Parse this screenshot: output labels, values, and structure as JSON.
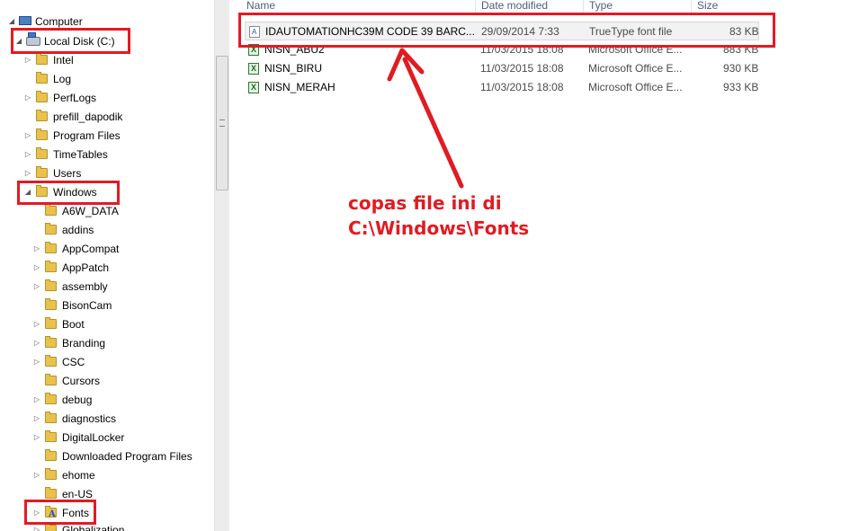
{
  "nav": {
    "items": [
      {
        "label": "Computer",
        "icon": "computer-icon",
        "expanded": true
      },
      {
        "label": "Local Disk (C:)",
        "icon": "local-disk-icon",
        "expanded": true
      },
      {
        "label": "Intel",
        "icon": "folder-icon"
      },
      {
        "label": "Log",
        "icon": "folder-icon"
      },
      {
        "label": "PerfLogs",
        "icon": "folder-icon"
      },
      {
        "label": "prefill_dapodik",
        "icon": "folder-icon"
      },
      {
        "label": "Program Files",
        "icon": "folder-icon"
      },
      {
        "label": "TimeTables",
        "icon": "folder-icon"
      },
      {
        "label": "Users",
        "icon": "folder-icon"
      },
      {
        "label": "Windows",
        "icon": "folder-icon",
        "expanded": true
      },
      {
        "label": "A6W_DATA",
        "icon": "folder-icon"
      },
      {
        "label": "addins",
        "icon": "folder-icon"
      },
      {
        "label": "AppCompat",
        "icon": "folder-icon"
      },
      {
        "label": "AppPatch",
        "icon": "folder-icon"
      },
      {
        "label": "assembly",
        "icon": "folder-icon"
      },
      {
        "label": "BisonCam",
        "icon": "folder-icon"
      },
      {
        "label": "Boot",
        "icon": "folder-icon"
      },
      {
        "label": "Branding",
        "icon": "folder-icon"
      },
      {
        "label": "CSC",
        "icon": "folder-icon"
      },
      {
        "label": "Cursors",
        "icon": "folder-icon"
      },
      {
        "label": "debug",
        "icon": "folder-icon"
      },
      {
        "label": "diagnostics",
        "icon": "folder-icon"
      },
      {
        "label": "DigitalLocker",
        "icon": "folder-icon"
      },
      {
        "label": "Downloaded Program Files",
        "icon": "folder-icon"
      },
      {
        "label": "ehome",
        "icon": "folder-icon"
      },
      {
        "label": "en-US",
        "icon": "folder-icon"
      },
      {
        "label": "Fonts",
        "icon": "fonts-folder-icon"
      },
      {
        "label": "Globalization",
        "icon": "folder-icon"
      }
    ]
  },
  "files": {
    "columns": {
      "name": "Name",
      "date": "Date modified",
      "type": "Type",
      "size": "Size"
    },
    "rows": [
      {
        "name": "IDAUTOMATIONHC39M CODE 39 BARC...",
        "date": "29/09/2014 7:33",
        "type": "TrueType font file",
        "size": "83 KB",
        "icon": "font-file-icon",
        "selected": true
      },
      {
        "name": "NISN_ABU2",
        "date": "11/03/2015 18:08",
        "type": "Microsoft Office E...",
        "size": "883 KB",
        "icon": "excel-file-icon"
      },
      {
        "name": "NISN_BIRU",
        "date": "11/03/2015 18:08",
        "type": "Microsoft Office E...",
        "size": "930 KB",
        "icon": "excel-file-icon"
      },
      {
        "name": "NISN_MERAH",
        "date": "11/03/2015 18:08",
        "type": "Microsoft Office E...",
        "size": "933 KB",
        "icon": "excel-file-icon"
      }
    ]
  },
  "annotation": {
    "line1": "copas file ini di",
    "line2": "C:\\Windows\\Fonts",
    "color": "#e11b22"
  }
}
